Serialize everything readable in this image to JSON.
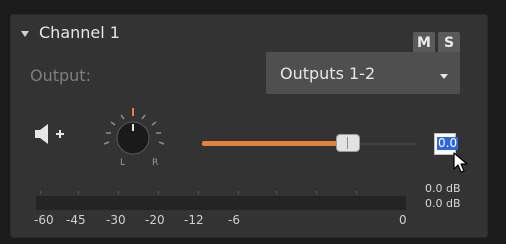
{
  "channel": {
    "title": "Channel 1",
    "mute_label": "M",
    "solo_label": "S"
  },
  "output": {
    "label": "Output:",
    "selected": "Outputs 1-2"
  },
  "pan": {
    "left_label": "L",
    "right_label": "R"
  },
  "volume": {
    "slider_level_percent": 68,
    "value": "0.0",
    "accent_color": "#e3823e"
  },
  "meter": {
    "left_db": "0.0 dB",
    "right_db": "0.0 dB",
    "scale": [
      "-60",
      "-45",
      "-30",
      "-20",
      "-12",
      "-6",
      "0"
    ]
  },
  "icons": {
    "collapse": "triangle-down-icon",
    "speaker": "speaker-plus-icon",
    "knob": "pan-knob-icon",
    "dropdown": "caret-down-icon",
    "cursor": "mouse-pointer-icon"
  }
}
